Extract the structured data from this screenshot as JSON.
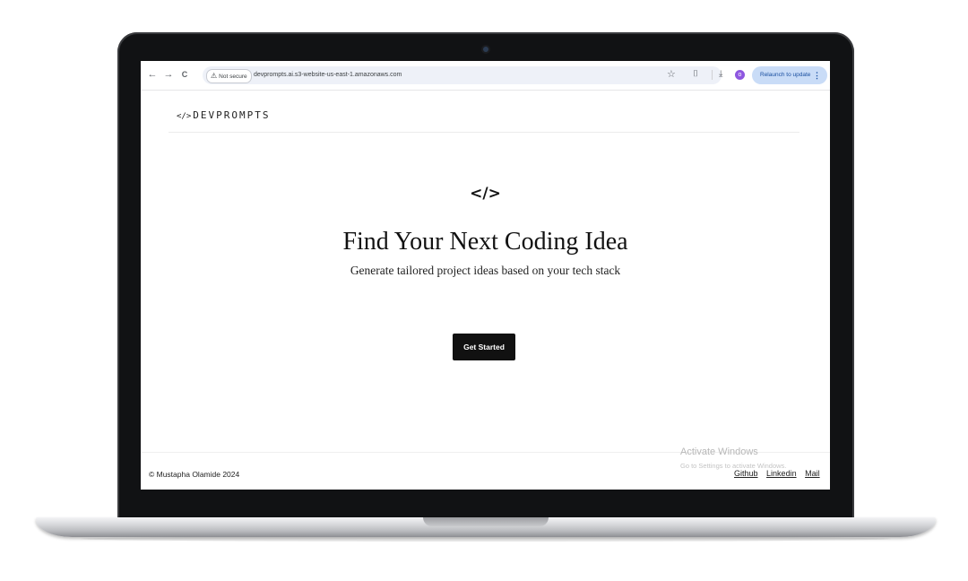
{
  "browser": {
    "back_icon": "←",
    "forward_icon": "→",
    "reload_icon": "C",
    "security_warning_icon": "⚠",
    "security_label": "Not secure",
    "url": "devprompts.ai.s3-website-us-east-1.amazonaws.com",
    "bookmark_icon": "☆",
    "extensions_icon": "⌷",
    "download_icon": "⤓",
    "profile_initial": "o",
    "relaunch_label": "Relaunch to update",
    "menu_icon": "⋮"
  },
  "header": {
    "logo_mark": "</>",
    "logo_text": "DEVPROMPTS"
  },
  "hero": {
    "icon": "</>",
    "title": "Find Your Next Coding Idea",
    "subtitle": "Generate tailored project ideas based on your tech stack",
    "cta_label": "Get Started"
  },
  "footer": {
    "copyright": "© Mustapha Olamide 2024",
    "links": [
      "Github",
      "Linkedin",
      "Mail"
    ]
  },
  "os_overlay": {
    "title": "Activate Windows",
    "subtitle": "Go to Settings to activate Windows."
  },
  "colors": {
    "cta_background": "#111111",
    "relaunch_chip": "#c9dcf7",
    "omnibox": "#eef1f8",
    "laptop_bezel": "#111214"
  }
}
